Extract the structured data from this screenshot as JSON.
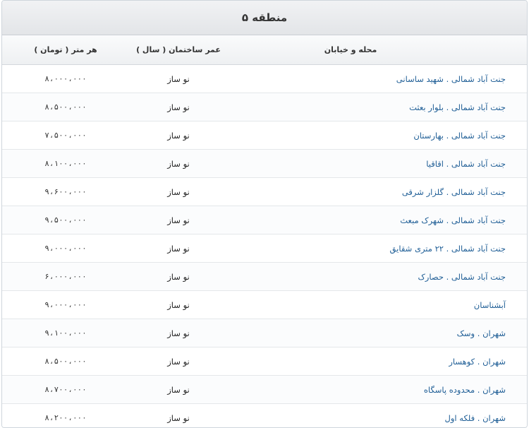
{
  "title": "منطقه ۵",
  "columns": {
    "name": "محله و خیابان",
    "age": "عمر ساختمان ( سال )",
    "price": "هر متر ( تومان )"
  },
  "rows": [
    {
      "name": "جنت آباد شمالی . شهید ساسانی",
      "age": "نو ساز",
      "price": "۸،۰۰۰،۰۰۰"
    },
    {
      "name": "جنت آباد شمالی . بلوار بعثت",
      "age": "نو ساز",
      "price": "۸،۵۰۰،۰۰۰"
    },
    {
      "name": "جنت آباد شمالی . بهارستان",
      "age": "نو ساز",
      "price": "۷،۵۰۰،۰۰۰"
    },
    {
      "name": "جنت آباد شمالی . اقاقیا",
      "age": "نو ساز",
      "price": "۸،۱۰۰،۰۰۰"
    },
    {
      "name": "جنت آباد شمالی . گلزار شرقی",
      "age": "نو ساز",
      "price": "۹،۶۰۰،۰۰۰"
    },
    {
      "name": "جنت آباد شمالی . شهرک مبعث",
      "age": "نو ساز",
      "price": "۹،۵۰۰،۰۰۰"
    },
    {
      "name": "جنت آباد شمالی . ۲۲ متری شقایق",
      "age": "نو ساز",
      "price": "۹،۰۰۰،۰۰۰"
    },
    {
      "name": "جنت آباد شمالی . حصارک",
      "age": "نو ساز",
      "price": "۶،۰۰۰،۰۰۰"
    },
    {
      "name": "آبشناسان",
      "age": "نو ساز",
      "price": "۹،۰۰۰،۰۰۰"
    },
    {
      "name": "شهران . وسک",
      "age": "نو ساز",
      "price": "۹،۱۰۰،۰۰۰"
    },
    {
      "name": "شهران . کوهسار",
      "age": "نو ساز",
      "price": "۸،۵۰۰،۰۰۰"
    },
    {
      "name": "شهران . محدوده پاسگاه",
      "age": "نو ساز",
      "price": "۸،۷۰۰،۰۰۰"
    },
    {
      "name": "شهران . فلکه اول",
      "age": "نو ساز",
      "price": "۸،۲۰۰،۰۰۰"
    }
  ]
}
